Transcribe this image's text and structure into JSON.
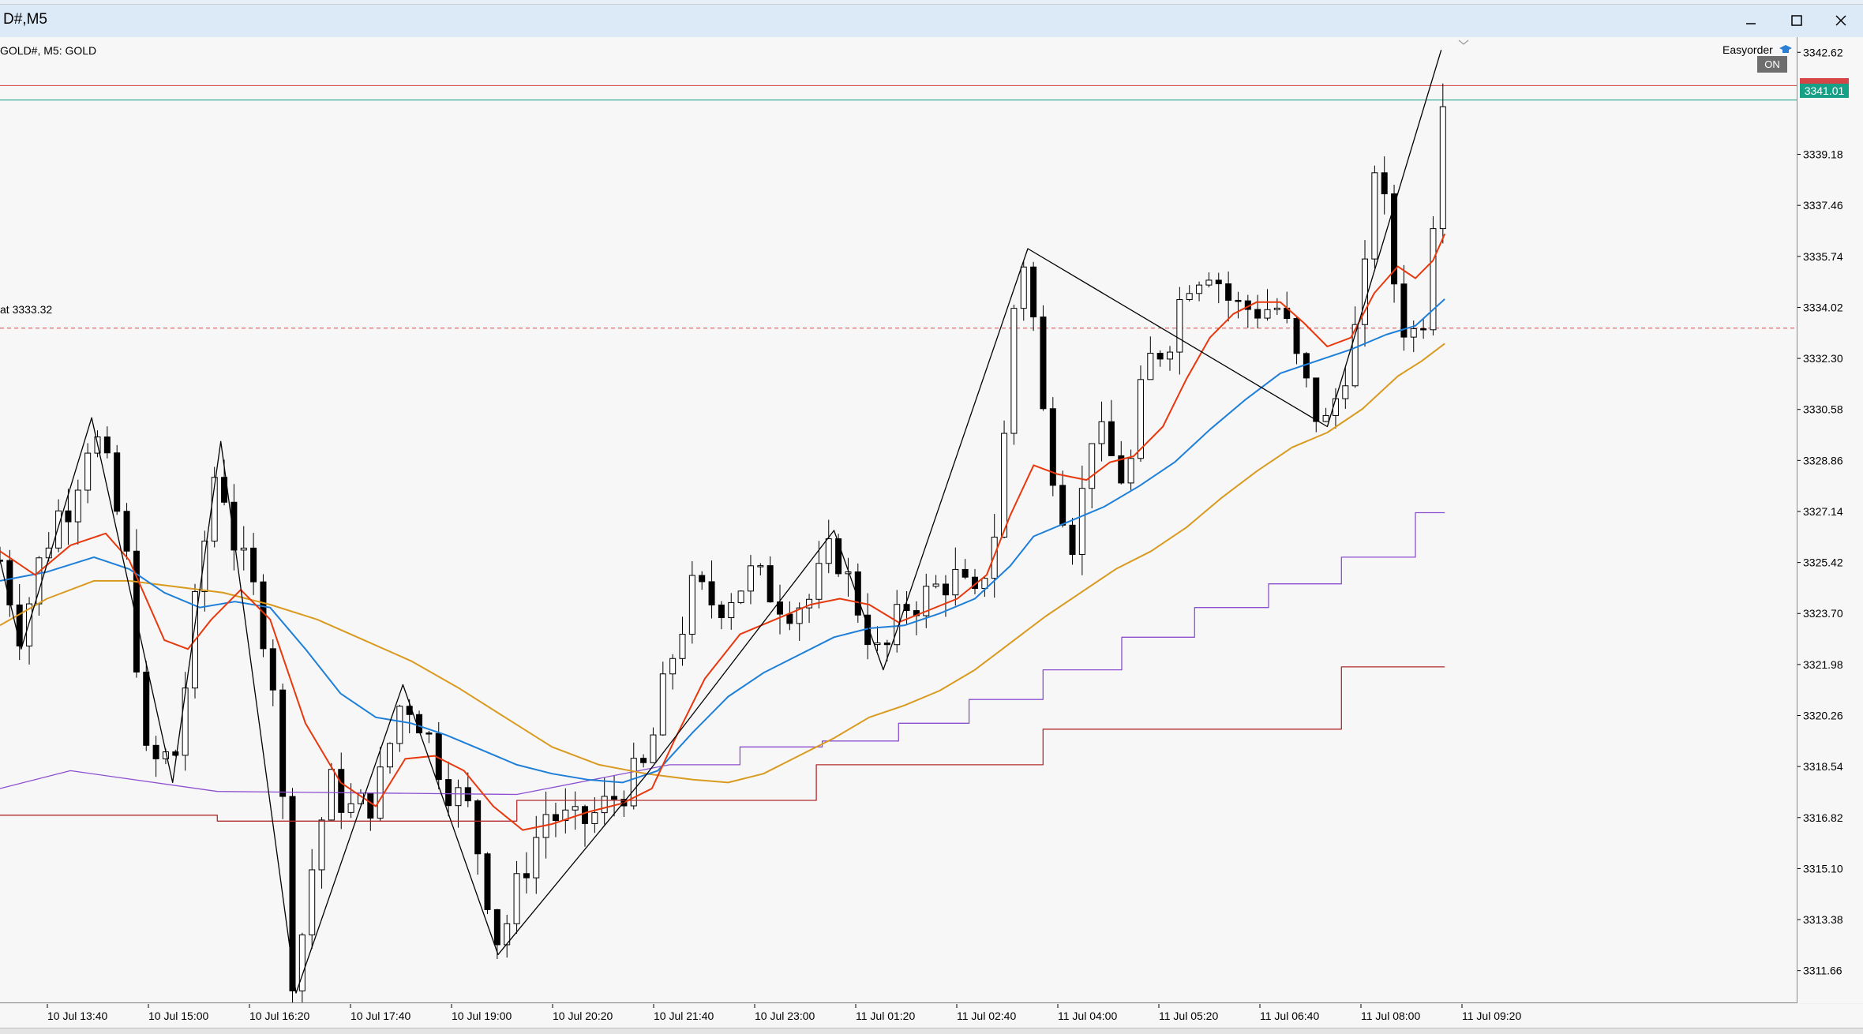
{
  "window": {
    "title": "D#,M5",
    "minimize_icon": "minimize-icon",
    "maximize_icon": "maximize-icon",
    "close_icon": "close-icon"
  },
  "chart": {
    "symbol_label": "GOLD#, M5:  GOLD",
    "alert_label": "at 3333.32",
    "easyorder_label": "Easyorder",
    "easyorder_icon": "graduation-cap-icon",
    "on_button": "ON",
    "bid_price": "3341.01",
    "colors": {
      "background": "#f7f7f7",
      "ema_fast": "#e8380d",
      "ema_mid": "#1e7fd8",
      "ema_slow": "#d99a1f",
      "upper_step": "#8c4fd0",
      "lower_step": "#b32c2c",
      "bid_line": "#16a085",
      "ask_line": "#d64545",
      "zigzag": "#000000"
    }
  },
  "chart_data": {
    "type": "candlestick",
    "title": "",
    "price_axis_ticks": [
      "3342.62",
      "3339.18",
      "3337.46",
      "3335.74",
      "3334.02",
      "3332.30",
      "3330.58",
      "3328.86",
      "3327.14",
      "3325.42",
      "3323.70",
      "3321.98",
      "3320.26",
      "3318.54",
      "3316.82",
      "3315.10",
      "3313.38",
      "3311.66"
    ],
    "time_axis_ticks": [
      "10 Jul 13:40",
      "10 Jul 15:00",
      "10 Jul 16:20",
      "10 Jul 17:40",
      "10 Jul 19:00",
      "10 Jul 20:20",
      "10 Jul 21:40",
      "10 Jul 23:00",
      "11 Jul 01:20",
      "11 Jul 02:40",
      "11 Jul 04:00",
      "11 Jul 05:20",
      "11 Jul 06:40",
      "11 Jul 08:00",
      "11 Jul 09:20"
    ],
    "ylim": [
      3310.8,
      3343.0
    ],
    "x_domain": [
      0,
      1246
    ],
    "close_series": [
      [
        0,
        3325.5
      ],
      [
        18,
        3323
      ],
      [
        30,
        3325
      ],
      [
        48,
        3327
      ],
      [
        60,
        3327.5
      ],
      [
        78,
        3330
      ],
      [
        95,
        3328
      ],
      [
        110,
        3325
      ],
      [
        125,
        3318.5
      ],
      [
        150,
        3319
      ],
      [
        170,
        3325
      ],
      [
        185,
        3329
      ],
      [
        200,
        3326
      ],
      [
        220,
        3324
      ],
      [
        235,
        3321
      ],
      [
        250,
        3311
      ],
      [
        265,
        3315
      ],
      [
        280,
        3318
      ],
      [
        300,
        3317
      ],
      [
        320,
        3317.5
      ],
      [
        343,
        3321
      ],
      [
        360,
        3320
      ],
      [
        380,
        3318
      ],
      [
        400,
        3317
      ],
      [
        425,
        3312.5
      ],
      [
        445,
        3315
      ],
      [
        465,
        3317
      ],
      [
        490,
        3316.5
      ],
      [
        510,
        3317
      ],
      [
        530,
        3317.8
      ],
      [
        550,
        3318.5
      ],
      [
        570,
        3322
      ],
      [
        590,
        3324.5
      ],
      [
        610,
        3324
      ],
      [
        640,
        3325
      ],
      [
        670,
        3324
      ],
      [
        690,
        3324.2
      ],
      [
        710,
        3326
      ],
      [
        730,
        3324
      ],
      [
        750,
        3322
      ],
      [
        770,
        3324
      ],
      [
        790,
        3324.3
      ],
      [
        810,
        3325
      ],
      [
        830,
        3324
      ],
      [
        850,
        3327
      ],
      [
        865,
        3335
      ],
      [
        875,
        3336
      ],
      [
        885,
        3331
      ],
      [
        900,
        3328
      ],
      [
        915,
        3326
      ],
      [
        930,
        3330
      ],
      [
        945,
        3329
      ],
      [
        960,
        3328
      ],
      [
        975,
        3332
      ],
      [
        995,
        3333
      ],
      [
        1010,
        3335
      ],
      [
        1030,
        3335.5
      ],
      [
        1050,
        3334
      ],
      [
        1070,
        3334
      ],
      [
        1090,
        3334
      ],
      [
        1105,
        3332
      ],
      [
        1120,
        3330.5
      ],
      [
        1130,
        3330
      ],
      [
        1145,
        3332
      ],
      [
        1160,
        3334
      ],
      [
        1170,
        3339
      ],
      [
        1180,
        3337
      ],
      [
        1190,
        3334
      ],
      [
        1200,
        3333
      ],
      [
        1210,
        3333.5
      ],
      [
        1218,
        3335
      ],
      [
        1225,
        3342.5
      ],
      [
        1230,
        3341
      ]
    ],
    "zigzag": [
      [
        0,
        3325.5
      ],
      [
        18,
        3322.5
      ],
      [
        78,
        3330.3
      ],
      [
        147,
        3318
      ],
      [
        188,
        3329.5
      ],
      [
        252,
        3310.9
      ],
      [
        343,
        3321.3
      ],
      [
        424,
        3312.2
      ],
      [
        549,
        3318.2
      ],
      [
        710,
        3326.5
      ],
      [
        752,
        3321.8
      ],
      [
        875,
        3336
      ],
      [
        1130,
        3330
      ],
      [
        1227,
        3342.7
      ]
    ],
    "ema_fast": [
      [
        0,
        3325.8
      ],
      [
        30,
        3325
      ],
      [
        60,
        3326
      ],
      [
        90,
        3326.4
      ],
      [
        110,
        3325.5
      ],
      [
        140,
        3322.8
      ],
      [
        160,
        3322.5
      ],
      [
        180,
        3323.5
      ],
      [
        205,
        3324.5
      ],
      [
        230,
        3323.5
      ],
      [
        260,
        3320
      ],
      [
        290,
        3318
      ],
      [
        320,
        3317.2
      ],
      [
        345,
        3318.8
      ],
      [
        370,
        3318.9
      ],
      [
        395,
        3318.4
      ],
      [
        420,
        3317.2
      ],
      [
        445,
        3316.4
      ],
      [
        470,
        3316.6
      ],
      [
        500,
        3317
      ],
      [
        530,
        3317.3
      ],
      [
        555,
        3317.8
      ],
      [
        575,
        3319.5
      ],
      [
        600,
        3321.5
      ],
      [
        630,
        3323
      ],
      [
        660,
        3323.5
      ],
      [
        690,
        3324
      ],
      [
        715,
        3324.2
      ],
      [
        740,
        3324
      ],
      [
        765,
        3323.4
      ],
      [
        790,
        3323.8
      ],
      [
        815,
        3324.2
      ],
      [
        840,
        3325
      ],
      [
        860,
        3327
      ],
      [
        880,
        3328.7
      ],
      [
        900,
        3328.4
      ],
      [
        925,
        3328.2
      ],
      [
        945,
        3328.8
      ],
      [
        965,
        3329
      ],
      [
        990,
        3330
      ],
      [
        1010,
        3331.6
      ],
      [
        1030,
        3333
      ],
      [
        1050,
        3333.8
      ],
      [
        1070,
        3334.2
      ],
      [
        1090,
        3334.2
      ],
      [
        1110,
        3333.5
      ],
      [
        1130,
        3332.7
      ],
      [
        1150,
        3333
      ],
      [
        1170,
        3334.5
      ],
      [
        1190,
        3335.4
      ],
      [
        1205,
        3335
      ],
      [
        1220,
        3335.6
      ],
      [
        1230,
        3336.5
      ]
    ],
    "ema_mid": [
      [
        0,
        3324.8
      ],
      [
        40,
        3325.1
      ],
      [
        80,
        3325.6
      ],
      [
        110,
        3325.2
      ],
      [
        140,
        3324.4
      ],
      [
        170,
        3323.9
      ],
      [
        200,
        3324.1
      ],
      [
        230,
        3323.9
      ],
      [
        260,
        3322.5
      ],
      [
        290,
        3321
      ],
      [
        320,
        3320.2
      ],
      [
        350,
        3320
      ],
      [
        380,
        3319.6
      ],
      [
        410,
        3319.1
      ],
      [
        440,
        3318.6
      ],
      [
        470,
        3318.3
      ],
      [
        500,
        3318.1
      ],
      [
        530,
        3318
      ],
      [
        560,
        3318.4
      ],
      [
        590,
        3319.7
      ],
      [
        620,
        3320.9
      ],
      [
        650,
        3321.7
      ],
      [
        680,
        3322.3
      ],
      [
        710,
        3322.9
      ],
      [
        740,
        3323.2
      ],
      [
        770,
        3323.3
      ],
      [
        800,
        3323.7
      ],
      [
        830,
        3324.2
      ],
      [
        860,
        3325.3
      ],
      [
        880,
        3326.3
      ],
      [
        910,
        3326.8
      ],
      [
        940,
        3327.3
      ],
      [
        970,
        3328
      ],
      [
        1000,
        3328.8
      ],
      [
        1030,
        3329.9
      ],
      [
        1060,
        3330.9
      ],
      [
        1090,
        3331.8
      ],
      [
        1120,
        3332.2
      ],
      [
        1150,
        3332.6
      ],
      [
        1180,
        3333.1
      ],
      [
        1205,
        3333.4
      ],
      [
        1230,
        3334.3
      ]
    ],
    "ema_slow": [
      [
        0,
        3323.3
      ],
      [
        40,
        3324.2
      ],
      [
        80,
        3324.8
      ],
      [
        110,
        3324.8
      ],
      [
        150,
        3324.6
      ],
      [
        190,
        3324.4
      ],
      [
        230,
        3324
      ],
      [
        270,
        3323.5
      ],
      [
        310,
        3322.8
      ],
      [
        350,
        3322.1
      ],
      [
        390,
        3321.2
      ],
      [
        430,
        3320.2
      ],
      [
        470,
        3319.2
      ],
      [
        510,
        3318.6
      ],
      [
        550,
        3318.3
      ],
      [
        590,
        3318.1
      ],
      [
        620,
        3318
      ],
      [
        650,
        3318.3
      ],
      [
        680,
        3318.9
      ],
      [
        710,
        3319.5
      ],
      [
        740,
        3320.2
      ],
      [
        770,
        3320.6
      ],
      [
        800,
        3321.1
      ],
      [
        830,
        3321.8
      ],
      [
        860,
        3322.7
      ],
      [
        890,
        3323.6
      ],
      [
        920,
        3324.4
      ],
      [
        950,
        3325.2
      ],
      [
        980,
        3325.8
      ],
      [
        1010,
        3326.6
      ],
      [
        1040,
        3327.6
      ],
      [
        1070,
        3328.5
      ],
      [
        1100,
        3329.3
      ],
      [
        1130,
        3329.8
      ],
      [
        1160,
        3330.6
      ],
      [
        1190,
        3331.7
      ],
      [
        1210,
        3332.2
      ],
      [
        1230,
        3332.8
      ]
    ],
    "upper_step": [
      [
        0,
        3317.8
      ],
      [
        60,
        3318.4
      ],
      [
        185,
        3317.7
      ],
      [
        440,
        3317.6
      ],
      [
        570,
        3318.6
      ],
      [
        630,
        3318.6
      ],
      [
        630,
        3319.2
      ],
      [
        700,
        3319.2
      ],
      [
        700,
        3319.4
      ],
      [
        765,
        3319.4
      ],
      [
        765,
        3320
      ],
      [
        825,
        3320
      ],
      [
        825,
        3320.8
      ],
      [
        888,
        3320.8
      ],
      [
        888,
        3321.8
      ],
      [
        955,
        3321.8
      ],
      [
        955,
        3322.9
      ],
      [
        1017,
        3322.9
      ],
      [
        1017,
        3323.9
      ],
      [
        1080,
        3323.9
      ],
      [
        1080,
        3324.7
      ],
      [
        1142,
        3324.7
      ],
      [
        1142,
        3325.6
      ],
      [
        1205,
        3325.6
      ],
      [
        1205,
        3327.1
      ],
      [
        1230,
        3327.1
      ]
    ],
    "lower_step": [
      [
        0,
        3316.9
      ],
      [
        185,
        3316.9
      ],
      [
        185,
        3316.7
      ],
      [
        440,
        3316.7
      ],
      [
        440,
        3317.4
      ],
      [
        695,
        3317.4
      ],
      [
        695,
        3318.6
      ],
      [
        888,
        3318.6
      ],
      [
        888,
        3319.8
      ],
      [
        1142,
        3319.8
      ],
      [
        1142,
        3321.9
      ],
      [
        1230,
        3321.9
      ]
    ],
    "horizontal_lines": [
      {
        "price": 3341.5,
        "color": "#d64545"
      },
      {
        "price": 3341.01,
        "color": "#16a085"
      },
      {
        "price": 3333.32,
        "color": "#d64545",
        "dashed": true
      }
    ]
  }
}
